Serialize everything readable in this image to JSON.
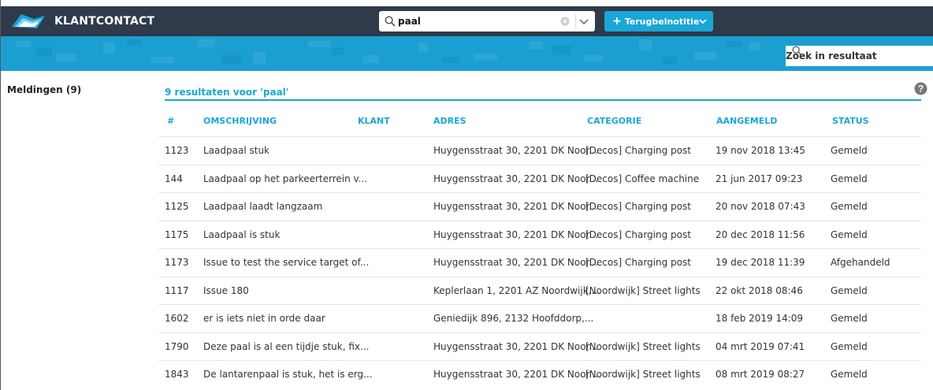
{
  "app": {
    "name": "KLANTCONTACT"
  },
  "search": {
    "value": "paal"
  },
  "create_button": {
    "label": "Terugbelnotitie"
  },
  "filter": {
    "placeholder": "Zoek in resultaat"
  },
  "sidebar": {
    "title": "Meldingen (9)"
  },
  "results": {
    "title": "9 resultaten voor 'paal'",
    "columns": {
      "id": "#",
      "description": "OMSCHRIJVING",
      "customer": "KLANT",
      "address": "ADRES",
      "category": "CATEGORIE",
      "reported": "AANGEMELD",
      "status": "STATUS"
    },
    "rows": [
      {
        "id": "1123",
        "description": "Laadpaal stuk",
        "address": "Huygensstraat 30, 2201 DK Noor...",
        "category": "[Decos] Charging post",
        "reported": "19 nov 2018 13:45",
        "status": "Gemeld"
      },
      {
        "id": "144",
        "description": "Laadpaal op het parkeerterrein v...",
        "address": "Huygensstraat 30, 2201 DK Noor...",
        "category": "[Decos] Coffee machine",
        "reported": "21 jun 2017 09:23",
        "status": "Gemeld"
      },
      {
        "id": "1125",
        "description": "Laadpaal laadt langzaam",
        "address": "Huygensstraat 30, 2201 DK Noor...",
        "category": "[Decos] Charging post",
        "reported": "20 nov 2018 07:43",
        "status": "Gemeld"
      },
      {
        "id": "1175",
        "description": "Laadpaal is stuk",
        "address": "Huygensstraat 30, 2201 DK Noor...",
        "category": "[Decos] Charging post",
        "reported": "20 dec 2018 11:56",
        "status": "Gemeld"
      },
      {
        "id": "1173",
        "description": "Issue to test the service target of...",
        "address": "Huygensstraat 30, 2201 DK Noor...",
        "category": "[Decos] Charging post",
        "reported": "19 dec 2018 11:39",
        "status": "Afgehandeld"
      },
      {
        "id": "1117",
        "description": "Issue 180",
        "address": "Keplerlaan 1, 2201 AZ Noordwijk,...",
        "category": "[Noordwijk] Street lights",
        "reported": "22 okt 2018 08:46",
        "status": "Gemeld"
      },
      {
        "id": "1602",
        "description": "er is iets niet in orde daar",
        "address": "Geniedijk 896, 2132 Hoofddorp,...",
        "category": "",
        "reported": "18 feb 2019 14:09",
        "status": "Gemeld"
      },
      {
        "id": "1790",
        "description": "Deze paal is al een tijdje stuk, fix...",
        "address": "Huygensstraat 30, 2201 DK Noor...",
        "category": "[Noordwijk] Street lights",
        "reported": "04 mrt 2019 07:41",
        "status": "Gemeld"
      },
      {
        "id": "1843",
        "description": "De lantarenpaal is stuk, het is erg...",
        "address": "Huygensstraat 30, 2201 DK Noor...",
        "category": "[Noordwijk] Street lights",
        "reported": "08 mrt 2019 08:27",
        "status": "Gemeld"
      }
    ]
  },
  "colors": {
    "topbar": "#2f3a4a",
    "accent": "#1aa6d6",
    "banner": "#1b9fd2"
  },
  "icons": [
    "app-logo-icon",
    "search-icon",
    "clear-icon",
    "chevron-down-icon",
    "plus-icon",
    "help-icon"
  ]
}
